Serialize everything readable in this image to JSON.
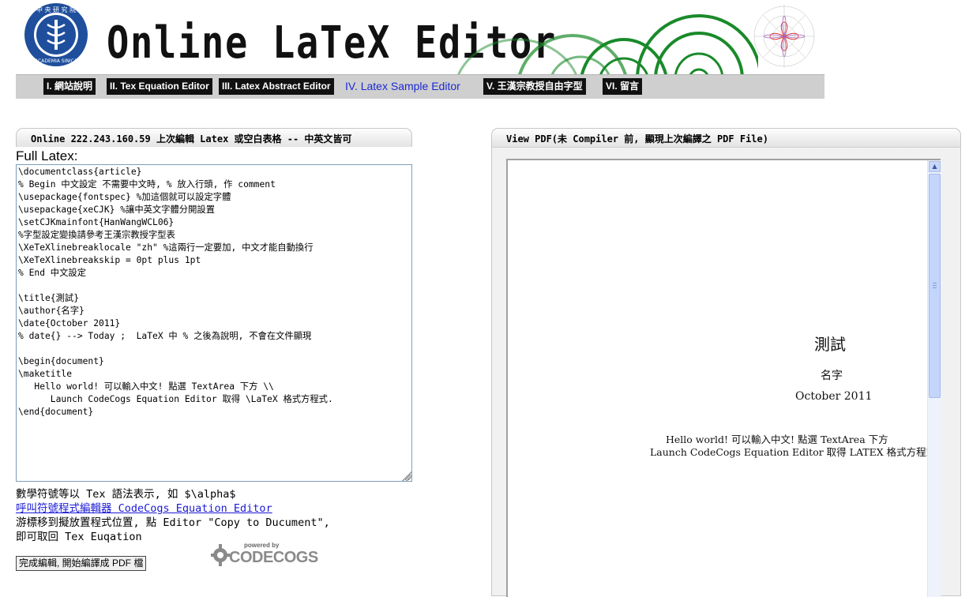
{
  "header": {
    "title": "Online LaTeX Editor",
    "logo_alt_text": "ACADEMIA SINICA"
  },
  "nav": {
    "items": [
      {
        "label": "I. 網站說明",
        "active": false
      },
      {
        "label": "II. Tex Equation Editor",
        "active": false
      },
      {
        "label": "III. Latex Abstract Editor",
        "active": false
      },
      {
        "label": "IV. Latex Sample Editor",
        "active": true
      },
      {
        "label": "V. 王漢宗教授自由字型",
        "active": false
      },
      {
        "label": "VI. 留言",
        "active": false
      }
    ]
  },
  "editor": {
    "header": "Online 222.243.160.59 上次編輯 Latex 或空白表格 -- 中英文皆可",
    "label": "Full Latex:",
    "content": "\\documentclass{article}\n% Begin 中文設定 不需要中文時, % 放入行頭, 作 comment\n\\usepackage{fontspec} %加這個就可以設定字體\n\\usepackage{xeCJK} %讓中英文字體分開設置\n\\setCJKmainfont{HanWangWCL06}\n%字型設定變換請參考王漢宗教授字型表\n\\XeTeXlinebreaklocale \"zh\" %這兩行一定要加, 中文才能自動換行\n\\XeTeXlinebreakskip = 0pt plus 1pt\n% End 中文設定\n\n\\title{測試}\n\\author{名字}\n\\date{October 2011}\n% date{} --> Today ;  LaTeX 中 % 之後為說明, 不會在文件顯現\n\n\\begin{document}\n\\maketitle\n   Hello world! 可以輸入中文! 點選 TextArea 下方 \\\\\n      Launch CodeCogs Equation Editor 取得 \\LaTeX 格式方程式.\n\\end{document}",
    "help_line1": "數學符號等以 Tex 語法表示, 如 $\\alpha$",
    "codecogs_link": "呼叫符號程式編輯器 CodeCogs Equation Editor ",
    "help_line2": "游標移到擬放置程式位置, 點 Editor \"Copy to Ducument\",",
    "help_line3": "即可取回 Tex Euqation",
    "compile_button": "完成編輯, 開始編譯成 PDF 檔",
    "codecogs_powered": "powered by",
    "codecogs_name": "CODECOGS"
  },
  "pdf_viewer": {
    "header": "View PDF(未 Compiler 前, 顯現上次編譯之 PDF File)",
    "document": {
      "title": "測試",
      "author": "名字",
      "date": "October 2011",
      "body_line1": "Hello world! 可以輸入中文! 點選 TextArea 下方",
      "body_line2": "Launch CodeCogs Equation Editor 取得 LATEX 格式方程式."
    }
  },
  "colors": {
    "nav_bar": "#cfcfcf",
    "nav_item": "#111111",
    "nav_active_text": "#1b29d6",
    "link": "#1a1ad6",
    "circle_green": "#1a8a2a",
    "logo_blue": "#1f4f9c"
  }
}
